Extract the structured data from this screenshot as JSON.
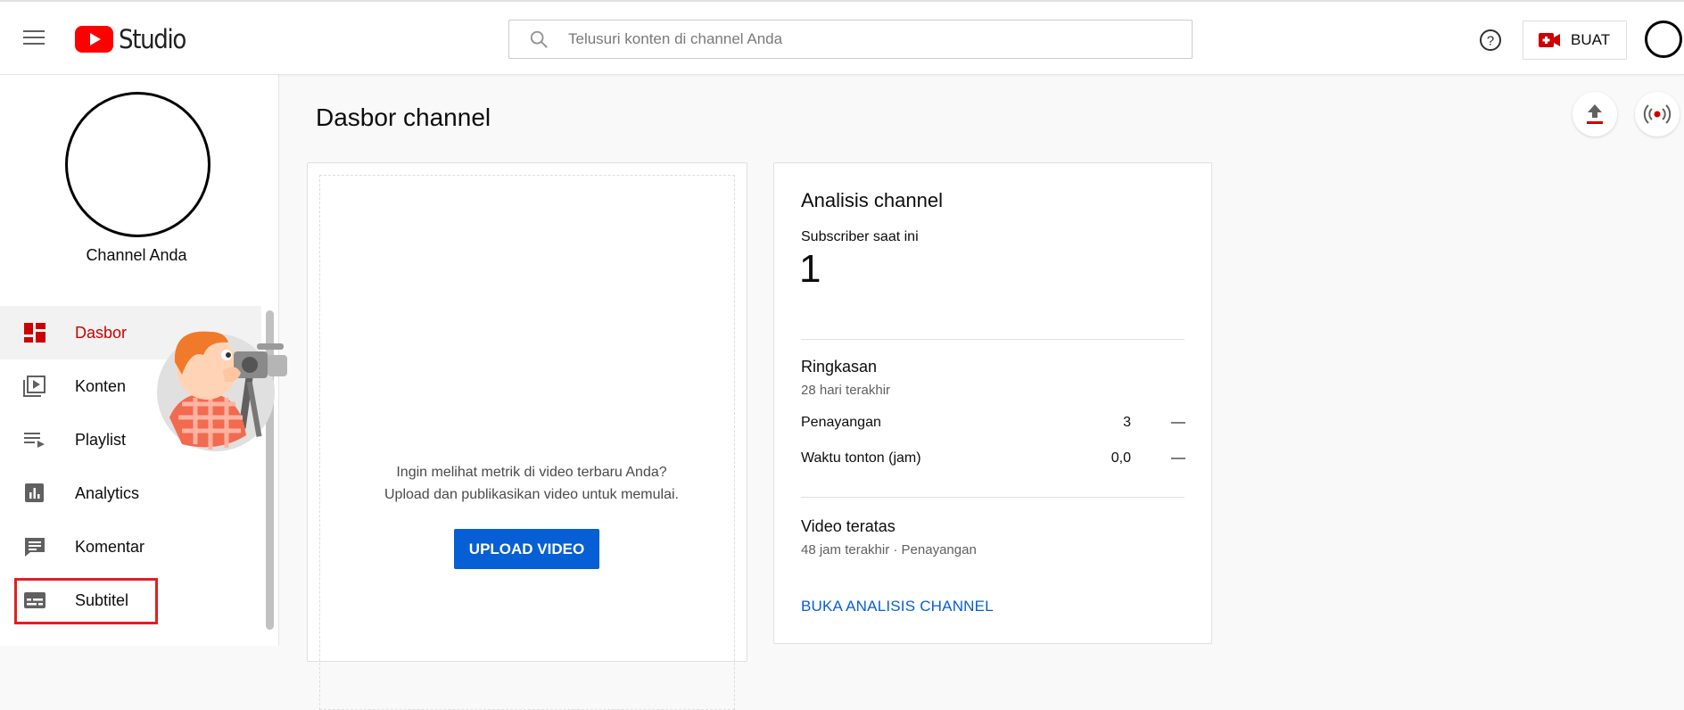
{
  "header": {
    "logo_text": "Studio",
    "search_placeholder": "Telusuri konten di channel Anda",
    "create_label": "BUAT"
  },
  "sidebar": {
    "channel_name": "Channel Anda",
    "items": [
      {
        "label": "Dasbor",
        "icon": "dashboard-icon",
        "active": true
      },
      {
        "label": "Konten",
        "icon": "content-icon",
        "active": false
      },
      {
        "label": "Playlist",
        "icon": "playlist-icon",
        "active": false
      },
      {
        "label": "Analytics",
        "icon": "analytics-icon",
        "active": false
      },
      {
        "label": "Komentar",
        "icon": "comments-icon",
        "active": false
      },
      {
        "label": "Subtitel",
        "icon": "subtitles-icon",
        "active": false
      }
    ]
  },
  "main": {
    "title": "Dasbor channel",
    "upload_card": {
      "line1": "Ingin melihat metrik di video terbaru Anda?",
      "line2": "Upload dan publikasikan video untuk memulai.",
      "button": "UPLOAD VIDEO"
    },
    "analytics_card": {
      "title": "Analisis channel",
      "subscribers_label": "Subscriber saat ini",
      "subscribers_value": "1",
      "summary_title": "Ringkasan",
      "summary_period": "28 hari terakhir",
      "metrics": [
        {
          "label": "Penayangan",
          "value": "3",
          "trend": "—"
        },
        {
          "label": "Waktu tonton (jam)",
          "value": "0,0",
          "trend": "—"
        }
      ],
      "top_videos_title": "Video teratas",
      "top_videos_sub": "48 jam terakhir · Penayangan",
      "link": "BUKA ANALISIS CHANNEL"
    }
  },
  "colors": {
    "brand_red": "#ff0000",
    "active_red": "#cc0000",
    "accent_blue": "#065fd4"
  }
}
